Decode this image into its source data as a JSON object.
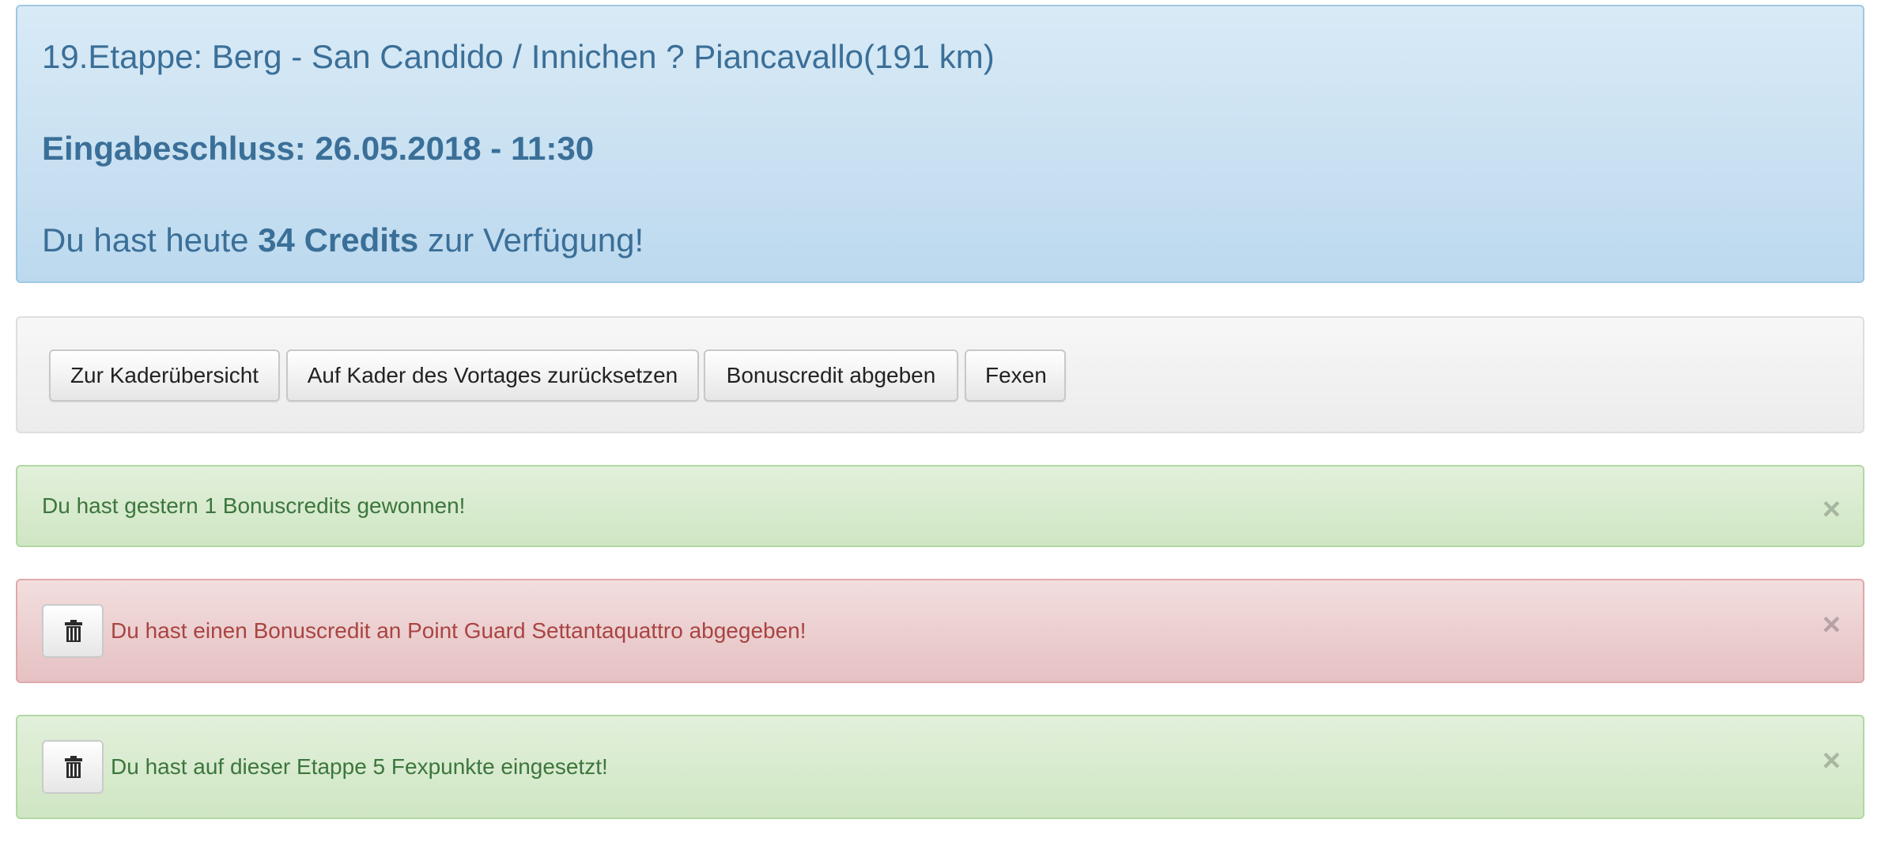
{
  "info": {
    "stage_title": "19.Etappe: Berg - San Candido / Innichen ? Piancavallo(191 km)",
    "deadline": "Eingabeschluss: 26.05.2018 - 11:30",
    "credits_prefix": "Du hast heute ",
    "credits_value": "34 Credits",
    "credits_suffix": " zur Verfügung!"
  },
  "toolbar": {
    "buttons": [
      {
        "label": "Zur Kaderübersicht"
      },
      {
        "label": "Auf Kader des Vortages zurücksetzen"
      },
      {
        "label": "Bonuscredit abgeben"
      },
      {
        "label": "Fexen"
      }
    ]
  },
  "alerts": [
    {
      "type": "success",
      "text": "Du hast gestern 1 Bonuscredits gewonnen!",
      "has_delete": false,
      "close": "×"
    },
    {
      "type": "danger",
      "text": "Du hast einen Bonuscredit an Point Guard Settantaquattro abgegeben!",
      "has_delete": true,
      "close": "×"
    },
    {
      "type": "success",
      "text": "Du hast auf dieser Etappe 5 Fexpunkte eingesetzt!",
      "has_delete": true,
      "close": "×"
    }
  ],
  "icons": {
    "delete": "trash-icon",
    "dismiss": "close-icon"
  },
  "colors": {
    "info_text": "#3a6f98",
    "success_text": "#3c763d",
    "danger_text": "#a94442"
  }
}
